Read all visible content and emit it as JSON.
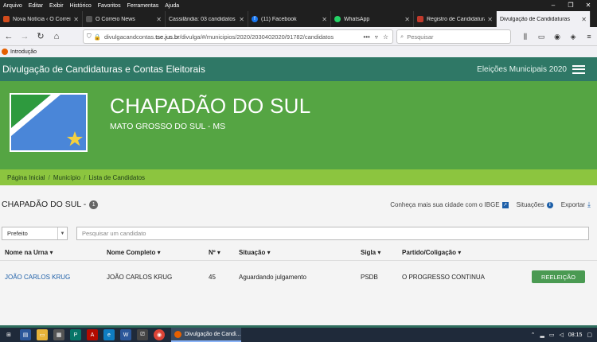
{
  "menubar": {
    "items": [
      "Arquivo",
      "Editar",
      "Exibir",
      "Histórico",
      "Favoritos",
      "Ferramentas",
      "Ajuda"
    ]
  },
  "tabs": [
    {
      "title": "Nova Notícia ‹ O Correio",
      "color": "#d24b1c"
    },
    {
      "title": "O Correio News",
      "color": "#444"
    },
    {
      "title": "Cassilândia: 03 candidatos a",
      "color": "#666"
    },
    {
      "title": "(11) Facebook",
      "color": "#1877f2"
    },
    {
      "title": "WhatsApp",
      "color": "#25d366"
    },
    {
      "title": "Registro de Candidaturas",
      "color": "#c0392b"
    },
    {
      "title": "Divulgação de Candidaturas",
      "color": "#e66000",
      "active": true
    }
  ],
  "nav": {
    "url_prefix": "divulgacandcontas.",
    "url_host": "tse.jus.br",
    "url_path": "/divulga/#/municipios/2020/2030402020/91782/candidatos",
    "search_placeholder": "Pesquisar"
  },
  "bookmarks": {
    "item": "Introdução"
  },
  "site": {
    "title": "Divulgação de Candidaturas e Contas Eleitorais",
    "elections": "Eleições Municipais 2020"
  },
  "hero": {
    "city": "CHAPADÃO DO SUL",
    "state": "MATO GROSSO DO SUL - MS"
  },
  "breadcrumb": [
    "Página Inicial",
    "Município",
    "Lista de Candidatos"
  ],
  "main": {
    "city_heading": "CHAPADÃO DO SUL -",
    "count": "1",
    "links": {
      "ibge": "Conheça mais sua cidade com o IBGE",
      "situacoes": "Situações",
      "exportar": "Exportar"
    },
    "role_select": "Prefeito",
    "search_placeholder": "Pesquisar um candidato"
  },
  "table": {
    "headers": [
      "Nome na Urna",
      "Nome Completo",
      "Nº",
      "Situação",
      "Sigla",
      "Partido/Coligação"
    ],
    "rows": [
      {
        "nome_urna": "JOÃO CARLOS KRUG",
        "nome_completo": "JOÃO CARLOS KRUG",
        "numero": "45",
        "situacao": "Aguardando julgamento",
        "sigla": "PSDB",
        "partido": "O PROGRESSO CONTINUA",
        "badge": "REELEIÇÃO"
      }
    ]
  },
  "taskbar": {
    "app": "Divulgação de Candi...",
    "time": "08:15"
  },
  "colors": {
    "header": "#2f7866",
    "hero": "#55a543",
    "breadcrumb": "#8cc53f",
    "reelection": "#4a9a52",
    "link": "#1d5fa8"
  }
}
